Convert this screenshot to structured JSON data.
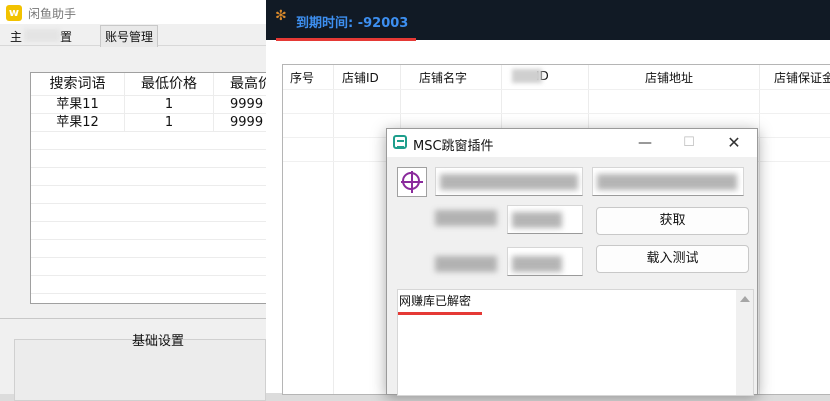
{
  "left_window": {
    "title": "闲鱼助手",
    "logo_glyph": "w",
    "tabs": [
      {
        "label": "主"
      },
      {
        "label": "置"
      },
      {
        "label": "账号管理"
      }
    ],
    "keyword_table": {
      "headers": [
        "搜索词语",
        "最低价格",
        "最高价"
      ],
      "rows": [
        [
          "苹果11",
          "1",
          "9999"
        ],
        [
          "苹果12",
          "1",
          "9999"
        ]
      ]
    },
    "base_settings_title": "基础设置"
  },
  "right_window": {
    "bug_icon": "bug-icon",
    "expiry_text": "到期时间: -92003",
    "accent_color": "#3d8ff0",
    "shop_table": {
      "headers": [
        "序号",
        "店铺ID",
        "店铺名字",
        "ID",
        "店铺地址",
        "店铺保证金"
      ]
    }
  },
  "dialog": {
    "title": "MSC跳窗插件",
    "icon": "dialog-app-icon",
    "buttons": {
      "fetch": "获取",
      "load_test": "载入测试"
    },
    "log_text": "网赚库已解密",
    "window_controls": {
      "minimize": "—",
      "maximize": "☐",
      "close": "✕"
    }
  }
}
